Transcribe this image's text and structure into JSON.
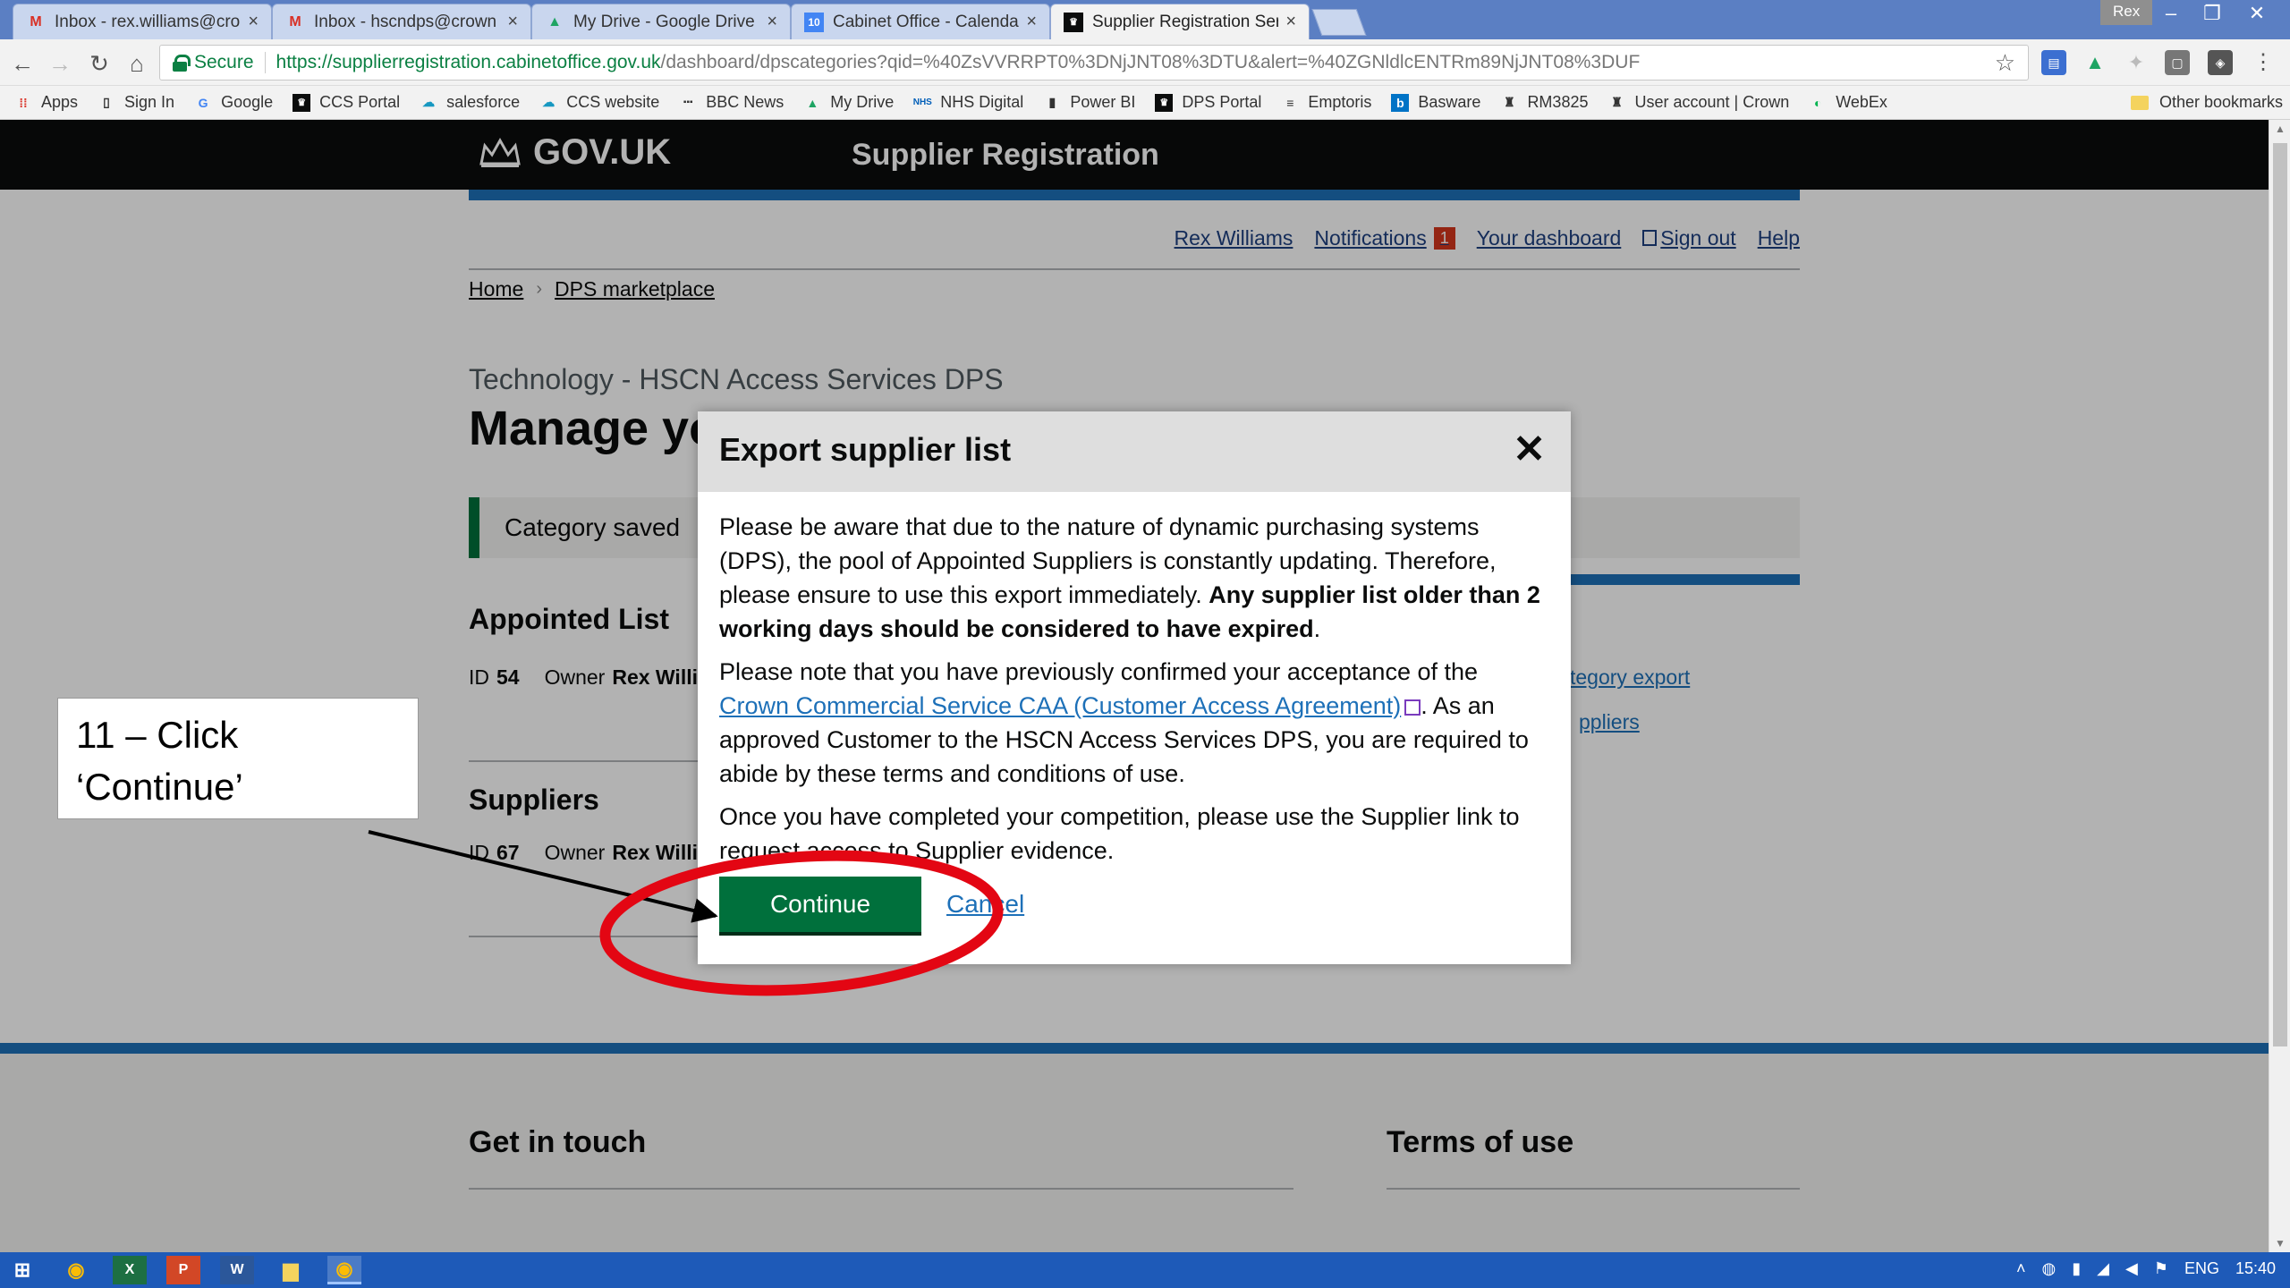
{
  "browser": {
    "tabs": [
      {
        "title": "Inbox - rex.williams@cro",
        "icon": "gmail-icon",
        "active": false
      },
      {
        "title": "Inbox - hscndps@crown",
        "icon": "gmail-icon",
        "active": false
      },
      {
        "title": "My Drive - Google Drive",
        "icon": "google-drive-icon",
        "active": false
      },
      {
        "title": "Cabinet Office - Calenda",
        "icon": "calendar-icon",
        "active": false
      },
      {
        "title": "Supplier Registration Ser",
        "icon": "crown-icon",
        "active": true
      }
    ],
    "profile": "Rex",
    "secure_label": "Secure",
    "url_host": "https://supplierregistration.cabinetoffice.gov.uk",
    "url_path": "/dashboard/dpscategories?qid=%40ZsVVRRPT0%3DNjJNT08%3DTU&alert=%40ZGNldlcENTRm89NjJNT08%3DUF",
    "bookmarks": [
      "Apps",
      "Sign In",
      "Google",
      "CCS Portal",
      "salesforce",
      "CCS website",
      "BBC News",
      "My Drive",
      "NHS Digital",
      "Power BI",
      "DPS Portal",
      "Emptoris",
      "Basware",
      "RM3825",
      "User account | Crown",
      "WebEx"
    ],
    "other_bookmarks": "Other bookmarks"
  },
  "site": {
    "logo": "GOV.UK",
    "service": "Supplier Registration",
    "nav": {
      "user": "Rex Williams",
      "notifications": "Notifications",
      "notif_count": "1",
      "dashboard": "Your dashboard",
      "signout": "Sign out",
      "help": "Help"
    },
    "breadcrumb": [
      "Home",
      "DPS marketplace"
    ],
    "caption": "Technology - HSCN Access Services DPS",
    "heading": "Manage yo",
    "banner": "Category saved",
    "side_links": [
      "tegory export",
      "ppliers"
    ],
    "appointed": {
      "heading": "Appointed List",
      "id_label": "ID",
      "id": "54",
      "owner_label": "Owner",
      "owner": "Rex Willi"
    },
    "suppliers": {
      "heading": "Suppliers",
      "id_label": "ID",
      "id": "67",
      "owner_label": "Owner",
      "owner": "Rex Willi"
    },
    "footer": {
      "get_in_touch": "Get in touch",
      "terms": "Terms of use"
    }
  },
  "modal": {
    "title": "Export supplier list",
    "p1_a": "Please be aware that due to the nature of dynamic purchasing systems (DPS), the pool of Appointed Suppliers is constantly updating. Therefore, please ensure to use this export immediately.",
    "p1_bold": "Any supplier list older than 2 working days should be considered to have expired",
    "p1_end": ".",
    "p2_a": "Please note that you have previously confirmed your acceptance of the",
    "p2_link": "Crown Commercial Service CAA (Customer Access Agreement)",
    "p2_b": ". As an approved Customer to the HSCN Access Services DPS, you are required to abide by these terms and conditions of use.",
    "p3": "Once you have completed your competition, please use the Supplier link to request access to Supplier evidence.",
    "continue": "Continue",
    "cancel": "Cancel"
  },
  "annotation": {
    "line1": "11 – Click",
    "line2": "‘Continue’"
  },
  "taskbar": {
    "lang": "ENG",
    "time": "15:40"
  },
  "colors": {
    "gov_green": "#00703c",
    "gov_blue": "#1d70b8",
    "annotation_red": "#e30613"
  }
}
